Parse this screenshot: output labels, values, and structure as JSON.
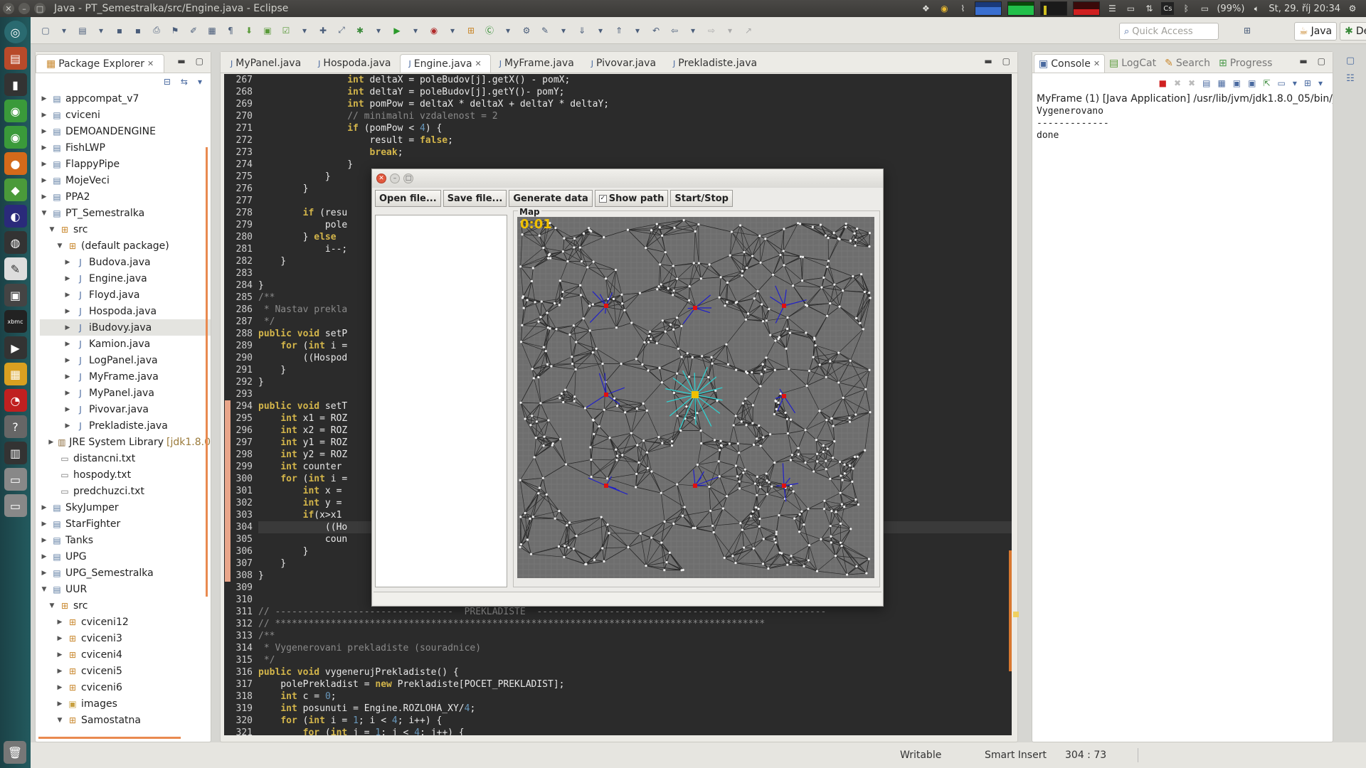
{
  "window": {
    "title": "Java - PT_Semestralka/src/Engine.java - Eclipse"
  },
  "tray": {
    "battery": "(99%)",
    "datetime": "St, 29. říj 20:34"
  },
  "toolbar": {
    "quick_access_placeholder": "Quick Access",
    "perspective_java": "Java",
    "perspective_debug": "Debug"
  },
  "package_explorer": {
    "tab_label": "Package Explorer",
    "items": [
      {
        "label": "appcompat_v7",
        "indent": 0,
        "icon": "project-icon",
        "expanded": false
      },
      {
        "label": "cviceni",
        "indent": 0,
        "icon": "project-icon",
        "expanded": false
      },
      {
        "label": "DEMOANDENGINE",
        "indent": 0,
        "icon": "project-icon",
        "expanded": false
      },
      {
        "label": "FishLWP",
        "indent": 0,
        "icon": "project-icon",
        "expanded": false
      },
      {
        "label": "FlappyPipe",
        "indent": 0,
        "icon": "project-icon",
        "expanded": false
      },
      {
        "label": "MojeVeci",
        "indent": 0,
        "icon": "project-icon",
        "expanded": false
      },
      {
        "label": "PPA2",
        "indent": 0,
        "icon": "project-icon",
        "expanded": false
      },
      {
        "label": "PT_Semestralka",
        "indent": 0,
        "icon": "project-icon",
        "expanded": true
      },
      {
        "label": "src",
        "indent": 1,
        "icon": "source-folder-icon",
        "expanded": true
      },
      {
        "label": "(default package)",
        "indent": 2,
        "icon": "package-icon",
        "expanded": true
      },
      {
        "label": "Budova.java",
        "indent": 3,
        "icon": "java-file-icon",
        "expanded": false
      },
      {
        "label": "Engine.java",
        "indent": 3,
        "icon": "java-file-icon",
        "expanded": false
      },
      {
        "label": "Floyd.java",
        "indent": 3,
        "icon": "java-file-icon",
        "expanded": false
      },
      {
        "label": "Hospoda.java",
        "indent": 3,
        "icon": "java-file-icon",
        "expanded": false
      },
      {
        "label": "iBudovy.java",
        "indent": 3,
        "icon": "java-file-icon",
        "expanded": false,
        "selected": true
      },
      {
        "label": "Kamion.java",
        "indent": 3,
        "icon": "java-file-icon",
        "expanded": false
      },
      {
        "label": "LogPanel.java",
        "indent": 3,
        "icon": "java-file-icon",
        "expanded": false
      },
      {
        "label": "MyFrame.java",
        "indent": 3,
        "icon": "java-file-icon",
        "expanded": false
      },
      {
        "label": "MyPanel.java",
        "indent": 3,
        "icon": "java-file-icon",
        "expanded": false
      },
      {
        "label": "Pivovar.java",
        "indent": 3,
        "icon": "java-file-icon",
        "expanded": false
      },
      {
        "label": "Prekladiste.java",
        "indent": 3,
        "icon": "java-file-icon",
        "expanded": false
      },
      {
        "label": "JRE System Library",
        "suffix": "[jdk1.8.0",
        "indent": 1,
        "icon": "library-icon",
        "expanded": false
      },
      {
        "label": "distancni.txt",
        "indent": 1,
        "icon": "text-file-icon",
        "leaf": true
      },
      {
        "label": "hospody.txt",
        "indent": 1,
        "icon": "text-file-icon",
        "leaf": true
      },
      {
        "label": "predchuzci.txt",
        "indent": 1,
        "icon": "text-file-icon",
        "leaf": true
      },
      {
        "label": "SkyJumper",
        "indent": 0,
        "icon": "project-icon",
        "expanded": false
      },
      {
        "label": "StarFighter",
        "indent": 0,
        "icon": "project-icon",
        "expanded": false
      },
      {
        "label": "Tanks",
        "indent": 0,
        "icon": "project-icon",
        "expanded": false
      },
      {
        "label": "UPG",
        "indent": 0,
        "icon": "project-icon",
        "expanded": false
      },
      {
        "label": "UPG_Semestralka",
        "indent": 0,
        "icon": "project-icon",
        "expanded": false
      },
      {
        "label": "UUR",
        "indent": 0,
        "icon": "project-icon",
        "expanded": true
      },
      {
        "label": "src",
        "indent": 1,
        "icon": "source-folder-icon",
        "expanded": true
      },
      {
        "label": "cviceni12",
        "indent": 2,
        "icon": "package-icon",
        "expanded": false
      },
      {
        "label": "cviceni3",
        "indent": 2,
        "icon": "package-icon",
        "expanded": false
      },
      {
        "label": "cviceni4",
        "indent": 2,
        "icon": "package-icon",
        "expanded": false
      },
      {
        "label": "cviceni5",
        "indent": 2,
        "icon": "package-icon",
        "expanded": false
      },
      {
        "label": "cviceni6",
        "indent": 2,
        "icon": "package-icon",
        "expanded": false
      },
      {
        "label": "images",
        "indent": 2,
        "icon": "folder-icon",
        "expanded": false
      },
      {
        "label": "Samostatna",
        "indent": 2,
        "icon": "package-icon",
        "expanded": true
      }
    ]
  },
  "editor": {
    "tabs": [
      {
        "label": "MyPanel.java",
        "active": false
      },
      {
        "label": "Hospoda.java",
        "active": false
      },
      {
        "label": "Engine.java",
        "active": true
      },
      {
        "label": "MyFrame.java",
        "active": false
      },
      {
        "label": "Pivovar.java",
        "active": false
      },
      {
        "label": "Prekladiste.java",
        "active": false
      }
    ],
    "lines": [
      {
        "n": "267",
        "t": "                int deltaX = poleBudov[j].getX() - pomX;"
      },
      {
        "n": "268",
        "t": "                int deltaY = poleBudov[j].getY()- pomY;"
      },
      {
        "n": "269",
        "t": "                int pomPow = deltaX * deltaX + deltaY * deltaY;"
      },
      {
        "n": "270",
        "t": "                // minimalni vzdalenost = 2"
      },
      {
        "n": "271",
        "t": "                if (pomPow < 4) {"
      },
      {
        "n": "272",
        "t": "                    result = false;"
      },
      {
        "n": "273",
        "t": "                    break;"
      },
      {
        "n": "274",
        "t": "                }"
      },
      {
        "n": "275",
        "t": "            }"
      },
      {
        "n": "276",
        "t": "        }"
      },
      {
        "n": "277",
        "t": ""
      },
      {
        "n": "278",
        "t": "        if (resu"
      },
      {
        "n": "279",
        "t": "            pole"
      },
      {
        "n": "280",
        "t": "        } else"
      },
      {
        "n": "281",
        "t": "            i--;"
      },
      {
        "n": "282",
        "t": "    }"
      },
      {
        "n": "283",
        "t": ""
      },
      {
        "n": "284",
        "t": "}"
      },
      {
        "n": "285",
        "t": "/**"
      },
      {
        "n": "286",
        "t": " * Nastav prekla"
      },
      {
        "n": "287",
        "t": " */"
      },
      {
        "n": "288",
        "t": "public void setP"
      },
      {
        "n": "289",
        "t": "    for (int i ="
      },
      {
        "n": "290",
        "t": "        ((Hospod"
      },
      {
        "n": "291",
        "t": "    }"
      },
      {
        "n": "292",
        "t": "}"
      },
      {
        "n": "293",
        "t": ""
      },
      {
        "n": "294",
        "t": "public void setT"
      },
      {
        "n": "295",
        "t": "    int x1 = ROZ"
      },
      {
        "n": "296",
        "t": "    int x2 = ROZ"
      },
      {
        "n": "297",
        "t": "    int y1 = ROZ"
      },
      {
        "n": "298",
        "t": "    int y2 = ROZ"
      },
      {
        "n": "299",
        "t": "    int counter"
      },
      {
        "n": "300",
        "t": "    for (int i ="
      },
      {
        "n": "301",
        "t": "        int x ="
      },
      {
        "n": "302",
        "t": "        int y ="
      },
      {
        "n": "303",
        "t": "        if(x>x1"
      },
      {
        "n": "304",
        "t": "            ((Ho"
      },
      {
        "n": "305",
        "t": "            coun"
      },
      {
        "n": "306",
        "t": "        }"
      },
      {
        "n": "307",
        "t": "    }"
      },
      {
        "n": "308",
        "t": "}"
      },
      {
        "n": "309",
        "t": ""
      },
      {
        "n": "310",
        "t": ""
      },
      {
        "n": "311",
        "t": "// --------------------------------  PREKLADISTE  ----------------------------------------------------"
      },
      {
        "n": "312",
        "t": "// ****************************************************************************************"
      },
      {
        "n": "313",
        "t": "/**"
      },
      {
        "n": "314",
        "t": " * Vygenerovani prekladiste (souradnice)"
      },
      {
        "n": "315",
        "t": " */"
      },
      {
        "n": "316",
        "t": "public void vygenerujPrekladiste() {"
      },
      {
        "n": "317",
        "t": "    polePrekladist = new Prekladiste[POCET_PREKLADIST];"
      },
      {
        "n": "318",
        "t": "    int c = 0;"
      },
      {
        "n": "319",
        "t": "    int posunuti = Engine.ROZLOHA_XY/4;"
      },
      {
        "n": "320",
        "t": "    for (int i = 1; i < 4; i++) {"
      },
      {
        "n": "321",
        "t": "        for (int j = 1; j < 4; j++) {"
      }
    ]
  },
  "console": {
    "tabs": [
      "Console",
      "LogCat",
      "Search",
      "Progress"
    ],
    "header": "MyFrame (1) [Java Application] /usr/lib/jvm/jdk1.8.0_05/bin/j",
    "output": [
      "Vygenerovano",
      "-------------",
      "done"
    ]
  },
  "app_window": {
    "buttons": {
      "open": "Open file...",
      "save": "Save file...",
      "generate": "Generate data",
      "show_path": "Show path",
      "start_stop": "Start/Stop"
    },
    "show_path_checked": true,
    "map_label": "Map",
    "timer": "0:01"
  },
  "statusbar": {
    "writable": "Writable",
    "insert_mode": "Smart Insert",
    "position": "304 : 73"
  }
}
